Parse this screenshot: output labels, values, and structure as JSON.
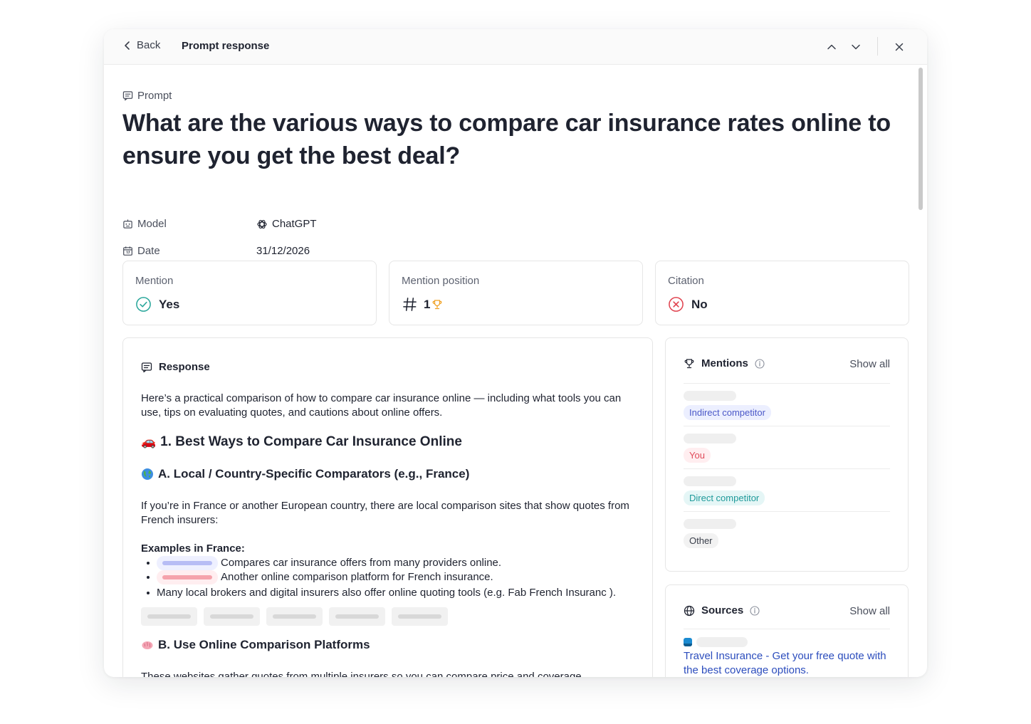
{
  "header": {
    "back_label": "Back",
    "title": "Prompt response"
  },
  "prompt": {
    "label": "Prompt",
    "text": "What are the various ways to compare car insurance rates online to ensure you get the best deal?"
  },
  "meta": {
    "model_label": "Model",
    "model_value": "ChatGPT",
    "date_label": "Date",
    "date_value": "31/12/2026"
  },
  "stats": {
    "mention_label": "Mention",
    "mention_value": "Yes",
    "position_label": "Mention position",
    "position_value": "1",
    "citation_label": "Citation",
    "citation_value": "No"
  },
  "response": {
    "heading": "Response",
    "intro": "Here’s a practical comparison of how to compare car insurance online — including what tools you can use, tips on evaluating quotes, and cautions about online offers.",
    "section1_emoji": "🚗",
    "section1_title": "1. Best Ways to Compare Car Insurance Online",
    "sectionA_title": "A. Local / Country-Specific Comparators (e.g., France)",
    "paragraphA": "If you’re in France or another European country, there are local comparison sites that show quotes from French insurers:",
    "examples_title": "Examples in France:",
    "bullet1": "Compares car insurance offers from many providers online.",
    "bullet2": "Another online comparison platform for French insurance.",
    "bullet3": "Many local brokers and digital insurers also offer online quoting tools (e.g. Fab French Insuranc  ).",
    "sectionB_title": "B. Use Online Comparison Platforms",
    "paragraphB": "These websites gather quotes from multiple insurers so you can compare price and coverage"
  },
  "mentions": {
    "title": "Mentions",
    "show_all": "Show all",
    "items": [
      {
        "tag": "Indirect competitor"
      },
      {
        "tag": "You"
      },
      {
        "tag": "Direct competitor"
      },
      {
        "tag": "Other"
      }
    ]
  },
  "sources": {
    "title": "Sources",
    "show_all": "Show all",
    "link_text": "Travel Insurance - Get your free quote with the best coverage options."
  },
  "colors": {
    "accent_blue": "#2c4dbd",
    "success_teal": "#2aa79b",
    "error_red": "#e0434f",
    "trophy_orange": "#f0a020"
  }
}
